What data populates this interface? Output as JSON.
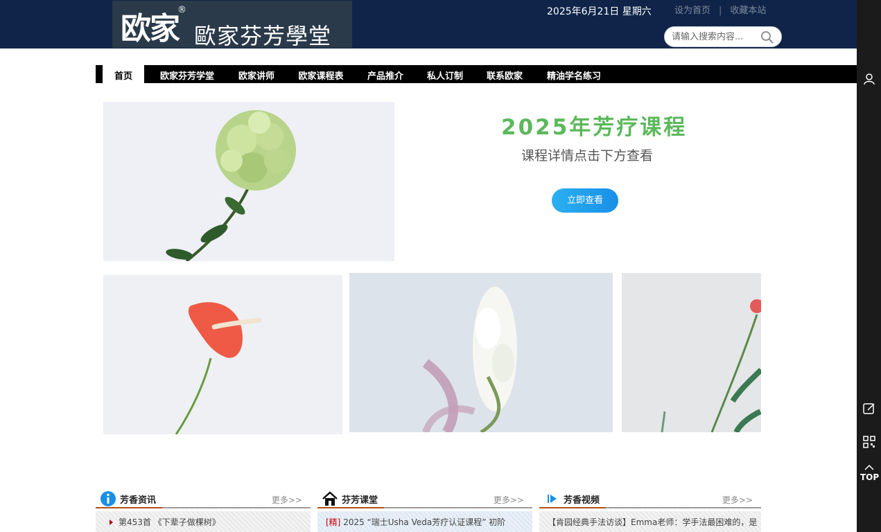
{
  "header": {
    "logo_mark": "欧家",
    "logo_reg": "®",
    "logo_name": "歐家芬芳學堂",
    "date": "2025年6月21日  星期六",
    "set_home": "设为首页",
    "separator": "|",
    "bookmark": "收藏本站",
    "search_placeholder": "请输入搜索内容..."
  },
  "nav": {
    "items": [
      {
        "label": "首页",
        "active": true
      },
      {
        "label": "欧家芬芳学堂"
      },
      {
        "label": "欧家讲师"
      },
      {
        "label": "欧家课程表"
      },
      {
        "label": "产品推介"
      },
      {
        "label": "私人订制"
      },
      {
        "label": "联系欧家"
      },
      {
        "label": "精油学名练习"
      }
    ]
  },
  "banner": {
    "title": "2025年芳疗课程",
    "subtitle": "课程详情点击下方查看",
    "button": "立即查看"
  },
  "sidebar_right": {
    "top_label": "TOP"
  },
  "columns": [
    {
      "title": "芳香资讯",
      "more": "更多>>",
      "item": "第453首 《下辈子做棵树》"
    },
    {
      "title": "芬芳课堂",
      "more": "更多>>",
      "tag": "[精]",
      "item": "2025 “瑞士Usha Veda芳疗认证课程” 初阶"
    },
    {
      "title": "芳香视频",
      "more": "更多>>",
      "item": "【肯园经典手法访谈】Emma老师：学手法最困难的，是"
    }
  ],
  "colors": {
    "header_bg": "#0f2448",
    "nav_bg": "#000000",
    "title_green": "#5cb85c",
    "button_blue": "#1a8fe8",
    "sidebar_bg": "#1b1b1b"
  }
}
